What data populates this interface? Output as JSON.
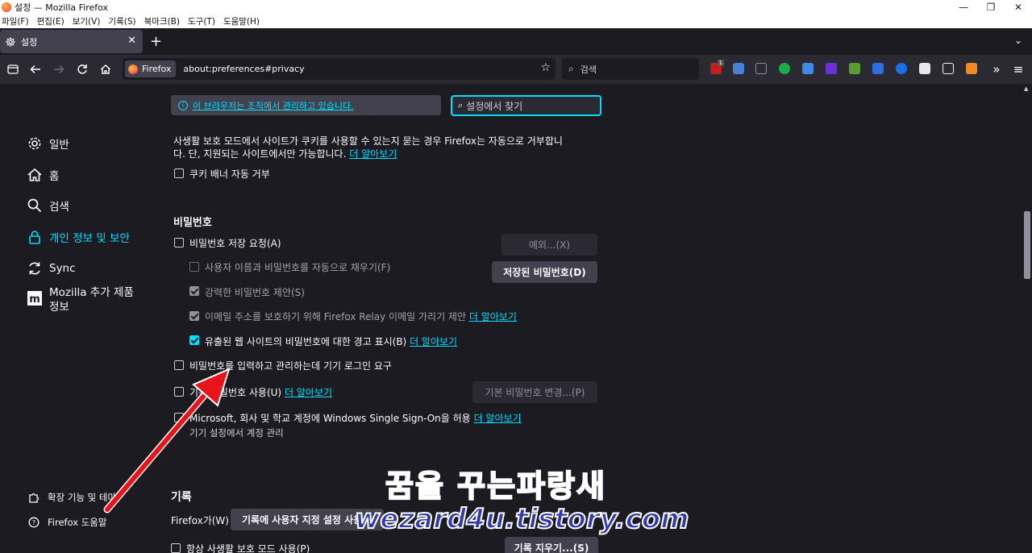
{
  "window": {
    "title": "설정 — Mozilla Firefox",
    "minimize": "—",
    "restore": "❐",
    "close": "✕"
  },
  "menu": [
    "파일(F)",
    "편집(E)",
    "보기(V)",
    "기록(S)",
    "북마크(B)",
    "도구(T)",
    "도움말(H)"
  ],
  "tab": {
    "label": "설정",
    "close": "✕",
    "new": "+",
    "list": "⌄"
  },
  "nav": {
    "identity_label": "Firefox",
    "url": "about:preferences#privacy",
    "search_placeholder": "검색",
    "ext_badge": "1"
  },
  "sidebar": {
    "items": [
      {
        "label": "일반",
        "icon": "gear-icon"
      },
      {
        "label": "홈",
        "icon": "home-icon"
      },
      {
        "label": "검색",
        "icon": "search-icon"
      },
      {
        "label": "개인 정보 및 보안",
        "icon": "lock-icon"
      },
      {
        "label": "Sync",
        "icon": "sync-icon"
      },
      {
        "label": "Mozilla 추가 제품",
        "label2": "정보",
        "icon": "mozilla-icon"
      }
    ],
    "footer": [
      {
        "label": "확장 기능 및 테마",
        "icon": "puzzle-icon"
      },
      {
        "label": "Firefox 도움말",
        "icon": "help-icon"
      }
    ]
  },
  "policy": {
    "text": "이 브라우저는 조직에서 관리하고 있습니다."
  },
  "find": {
    "placeholder": "설정에서 찾기"
  },
  "cookies": {
    "desc1": "사생활 보호 모드에서 사이트가 쿠키를 사용할 수 있는지 묻는 경우 Firefox는 자동으로 거부합니",
    "desc2": "다. 단, 지원되는 사이트에서만 가능합니다.",
    "learn_more": "더 알아보기",
    "reject_banner": "쿠키 배너 자동 거부"
  },
  "passwords": {
    "heading": "비밀번호",
    "ask_save": "비밀번호 저장 요청(A)",
    "exceptions": "예외...(X)",
    "autofill": "사용자 이름과 비밀번호를 자동으로 채우기(F)",
    "saved": "저장된 비밀번호(D)",
    "suggest": "강력한 비밀번호 제안(S)",
    "relay": "이메일 주소를 보호하기 위해 Firefox Relay 이메일 가리기 제안",
    "breach": "유출된 웹 사이트의 비밀번호에 대한 경고 표시(B)",
    "device_login": "비밀번호를 입력하고 관리하는데 기기 로그인 요구",
    "primary": "기본 비밀번호 사용(U)",
    "change_primary": "기본 비밀번호 변경...(P)",
    "sso": "Microsoft, 회사 및 학교 계정에 Windows Single Sign-On을 허용",
    "sso_sub": "기기 설정에서 계정 관리",
    "learn_more": "더 알아보기"
  },
  "history": {
    "heading": "기록",
    "firefox_will": "Firefox가(W)",
    "mode": "기록에 사용자 지정 설정 사용",
    "private_always": "항상 사생활 보호 모드 사용(P)",
    "clear": "기록 지우기...(S)"
  },
  "watermark": {
    "line1": "꿈을 꾸는파랑새",
    "line2": "wezard4u.tistory.com"
  },
  "colors": {
    "accent": "#00ddff",
    "bg": "#1c1b22",
    "toolbar": "#2b2a33",
    "button": "#42414d",
    "arrow": "#e8141c"
  }
}
